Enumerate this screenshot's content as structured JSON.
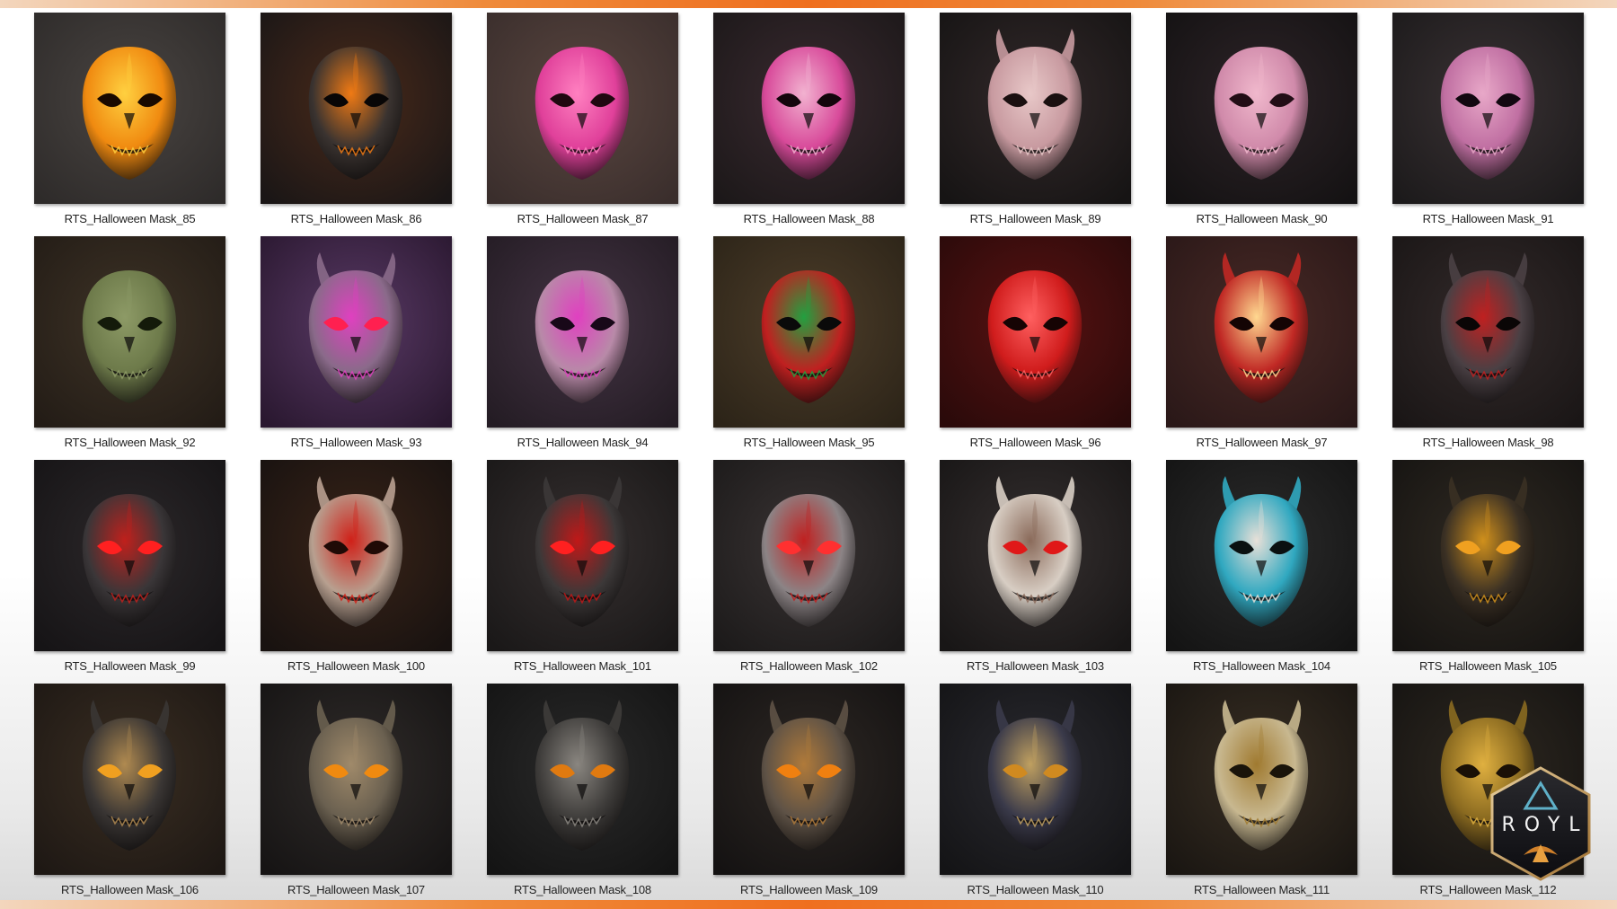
{
  "logo": {
    "text": "ROYL",
    "icon": "hexagon-logo-icon"
  },
  "items": [
    {
      "label": "RTS_Halloween Mask_85",
      "bg": "#2e2b2a",
      "glow": "#4a4542",
      "mask": "#f08a10",
      "accent": "#ffd040",
      "eyes": "#1a0a00",
      "horns": false
    },
    {
      "label": "RTS_Halloween Mask_86",
      "bg": "#1a1616",
      "glow": "#4a2a1a",
      "mask": "#3a3330",
      "accent": "#f07a14",
      "eyes": "#080606",
      "horns": false
    },
    {
      "label": "RTS_Halloween Mask_87",
      "bg": "#3a2e2c",
      "glow": "#5a4640",
      "mask": "#e0409a",
      "accent": "#ff80c0",
      "eyes": "#200810",
      "horns": false
    },
    {
      "label": "RTS_Halloween Mask_88",
      "bg": "#1c1819",
      "glow": "#3a2a30",
      "mask": "#d84a9a",
      "accent": "#f2b2d0",
      "eyes": "#14060c",
      "horns": false
    },
    {
      "label": "RTS_Halloween Mask_89",
      "bg": "#161414",
      "glow": "#33292a",
      "mask": "#c89aa0",
      "accent": "#e8c8c8",
      "eyes": "#1a1010",
      "horns": true
    },
    {
      "label": "RTS_Halloween Mask_90",
      "bg": "#141213",
      "glow": "#2e2428",
      "mask": "#d08aaa",
      "accent": "#f0b8cc",
      "eyes": "#220e16",
      "horns": false
    },
    {
      "label": "RTS_Halloween Mask_91",
      "bg": "#1c1a1b",
      "glow": "#3a3234",
      "mask": "#c06fa2",
      "accent": "#e8a8c8",
      "eyes": "#120810",
      "horns": false
    },
    {
      "label": "RTS_Halloween Mask_92",
      "bg": "#231c16",
      "glow": "#3e3326",
      "mask": "#6d7a4a",
      "accent": "#8d9a66",
      "eyes": "#141a0a",
      "horns": false
    },
    {
      "label": "RTS_Halloween Mask_93",
      "bg": "#2a1830",
      "glow": "#5a3a66",
      "mask": "#8a6a8a",
      "accent": "#e040c0",
      "eyes": "#ff2050",
      "horns": true
    },
    {
      "label": "RTS_Halloween Mask_94",
      "bg": "#241c24",
      "glow": "#443444",
      "mask": "#b88aa8",
      "accent": "#e040c0",
      "eyes": "#180818",
      "horns": false
    },
    {
      "label": "RTS_Halloween Mask_95",
      "bg": "#2c2418",
      "glow": "#4e3e2a",
      "mask": "#c02020",
      "accent": "#22a040",
      "eyes": "#0a0a0a",
      "horns": false
    },
    {
      "label": "RTS_Halloween Mask_96",
      "bg": "#2a0a0a",
      "glow": "#5a1212",
      "mask": "#d01c1c",
      "accent": "#ff6060",
      "eyes": "#160404",
      "horns": false
    },
    {
      "label": "RTS_Halloween Mask_97",
      "bg": "#2a1818",
      "glow": "#4a2a26",
      "mask": "#c02824",
      "accent": "#ffd890",
      "eyes": "#140404",
      "horns": true
    },
    {
      "label": "RTS_Halloween Mask_98",
      "bg": "#1a1616",
      "glow": "#332a2a",
      "mask": "#4a4044",
      "accent": "#c02020",
      "eyes": "#0a0606",
      "horns": true
    },
    {
      "label": "RTS_Halloween Mask_99",
      "bg": "#161416",
      "glow": "#2c282a",
      "mask": "#3a3638",
      "accent": "#c0201c",
      "eyes": "#ff2020",
      "horns": false
    },
    {
      "label": "RTS_Halloween Mask_100",
      "bg": "#181210",
      "glow": "#3a2418",
      "mask": "#b8a090",
      "accent": "#d02018",
      "eyes": "#200a06",
      "horns": true
    },
    {
      "label": "RTS_Halloween Mask_101",
      "bg": "#1a1818",
      "glow": "#363030",
      "mask": "#3c3838",
      "accent": "#c01818",
      "eyes": "#ff2020",
      "horns": true
    },
    {
      "label": "RTS_Halloween Mask_102",
      "bg": "#1c1a1a",
      "glow": "#3a3434",
      "mask": "#8c8486",
      "accent": "#c02020",
      "eyes": "#ff3030",
      "horns": false
    },
    {
      "label": "RTS_Halloween Mask_103",
      "bg": "#181616",
      "glow": "#363030",
      "mask": "#d8cec4",
      "accent": "#8a6a5a",
      "eyes": "#e01818",
      "horns": true
    },
    {
      "label": "RTS_Halloween Mask_104",
      "bg": "#141414",
      "glow": "#2c2c2c",
      "mask": "#30a8c0",
      "accent": "#e8e0d8",
      "eyes": "#0a1010",
      "horns": true
    },
    {
      "label": "RTS_Halloween Mask_105",
      "bg": "#161412",
      "glow": "#302a22",
      "mask": "#3a3024",
      "accent": "#d0901c",
      "eyes": "#f0a020",
      "horns": true
    },
    {
      "label": "RTS_Halloween Mask_106",
      "bg": "#1e1814",
      "glow": "#3a2e22",
      "mask": "#3a3634",
      "accent": "#b08a50",
      "eyes": "#f0a020",
      "horns": true
    },
    {
      "label": "RTS_Halloween Mask_107",
      "bg": "#161414",
      "glow": "#302c2a",
      "mask": "#6a6050",
      "accent": "#a08a6a",
      "eyes": "#f08a10",
      "horns": true
    },
    {
      "label": "RTS_Halloween Mask_108",
      "bg": "#141414",
      "glow": "#2a2a2a",
      "mask": "#3e3c3a",
      "accent": "#8a8680",
      "eyes": "#e07a10",
      "horns": true
    },
    {
      "label": "RTS_Halloween Mask_109",
      "bg": "#141212",
      "glow": "#2e2824",
      "mask": "#5e5246",
      "accent": "#b07a3a",
      "eyes": "#f08010",
      "horns": true
    },
    {
      "label": "RTS_Halloween Mask_110",
      "bg": "#141416",
      "glow": "#2a2a30",
      "mask": "#3a3a4a",
      "accent": "#c0a060",
      "eyes": "#d08a20",
      "horns": true
    },
    {
      "label": "RTS_Halloween Mask_111",
      "bg": "#1a1612",
      "glow": "#3a3024",
      "mask": "#c8b890",
      "accent": "#a07a30",
      "eyes": "#1a140a",
      "horns": true
    },
    {
      "label": "RTS_Halloween Mask_112",
      "bg": "#161412",
      "glow": "#2e2820",
      "mask": "#8a6a20",
      "accent": "#e0b040",
      "eyes": "#1a1006",
      "horns": true
    }
  ]
}
